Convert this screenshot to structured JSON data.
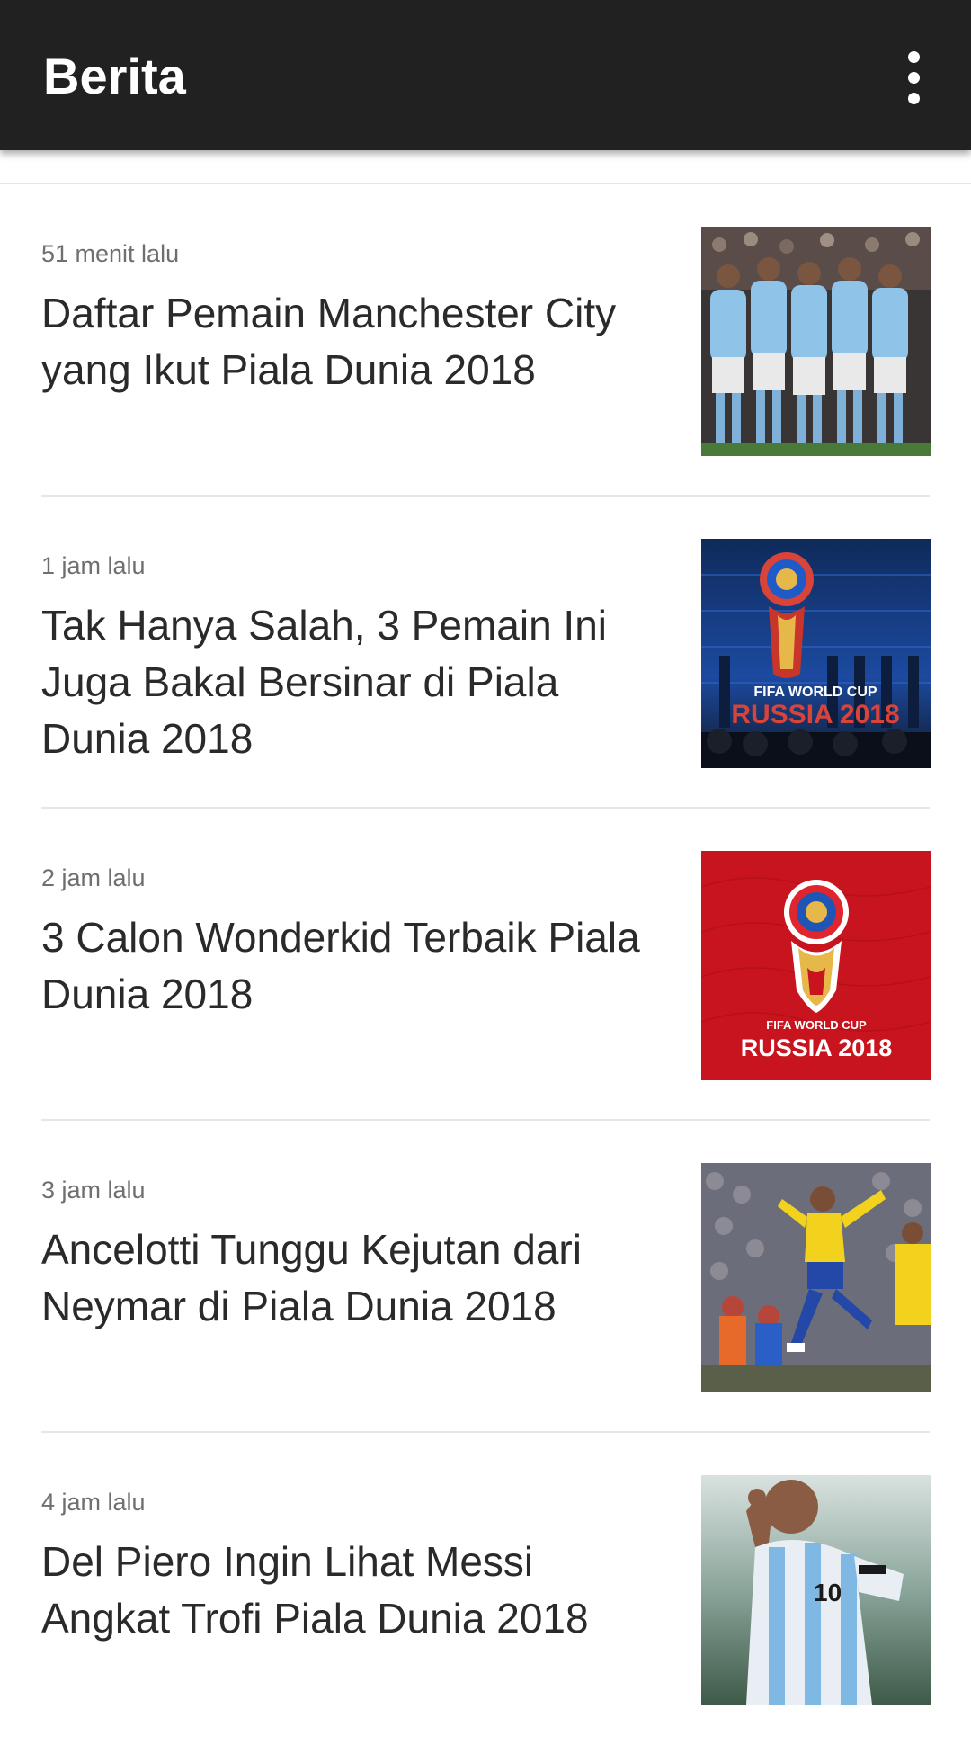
{
  "appbar": {
    "title": "Berita",
    "menu_icon": "more-vert-icon"
  },
  "articles": [
    {
      "time": "51 menit lalu",
      "headline": "Daftar Pemain Manchester City yang Ikut Piala Dunia 2018",
      "thumbnail": "team-photo"
    },
    {
      "time": "1 jam lalu",
      "headline": "Tak Hanya Salah, 3 Pemain Ini Juga Bakal Bersinar di Piala Dunia 2018",
      "thumbnail": "world-cup-projection",
      "thumbnail_text_1": "FIFA WORLD CUP",
      "thumbnail_text_2": "RUSSIA 2018"
    },
    {
      "time": "2 jam lalu",
      "headline": "3 Calon Wonderkid Terbaik Piala Dunia 2018",
      "thumbnail": "world-cup-logo",
      "thumbnail_text_1": "FIFA WORLD CUP",
      "thumbnail_text_2": "RUSSIA 2018"
    },
    {
      "time": "3 jam lalu",
      "headline": "Ancelotti Tunggu Kejutan dari Neymar di Piala Dunia 2018",
      "thumbnail": "player-celebration"
    },
    {
      "time": "4 jam lalu",
      "headline": "Del Piero Ingin Lihat Messi Angkat Trofi Piala Dunia 2018",
      "thumbnail": "player-portrait"
    }
  ],
  "colors": {
    "appbar_bg": "#212121",
    "headline": "#2a2a2a",
    "timestamp": "#6f6f6f",
    "divider": "#e6e6e6"
  }
}
